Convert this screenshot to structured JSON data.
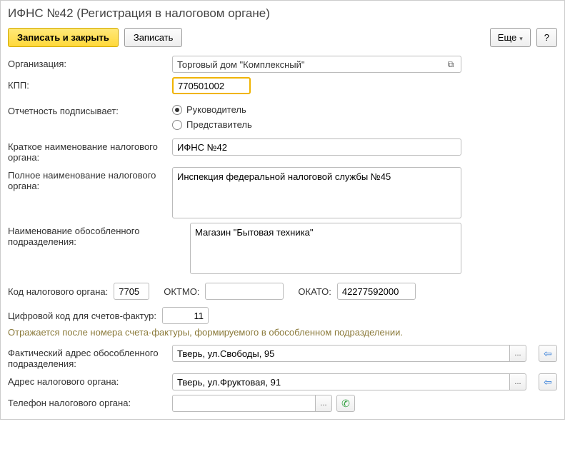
{
  "title": "ИФНС №42 (Регистрация в налоговом органе)",
  "toolbar": {
    "save_close": "Записать и закрыть",
    "save": "Записать",
    "more": "Еще",
    "help": "?"
  },
  "labels": {
    "org": "Организация:",
    "kpp": "КПП:",
    "signer": "Отчетность подписывает:",
    "short_name": "Краткое наименование налогового органа:",
    "full_name": "Полное наименование налогового органа:",
    "subdivision": "Наименование обособленного подразделения:",
    "tax_code": "Код налогового органа:",
    "oktmo": "ОКТМО:",
    "okato": "ОКАТО:",
    "digital_code": "Цифровой код для счетов-фактур:",
    "hint": "Отражается после номера счета-фактуры, формируемого в обособленном подразделении.",
    "actual_address": "Фактический адрес обособленного подразделения:",
    "tax_address": "Адрес налогового органа:",
    "phone": "Телефон налогового органа:"
  },
  "signer_options": {
    "director": "Руководитель",
    "representative": "Представитель",
    "selected": "director"
  },
  "values": {
    "org": "Торговый дом \"Комплексный\"",
    "kpp": "770501002",
    "short_name": "ИФНС №42",
    "full_name": "Инспекция федеральной налоговой службы №45",
    "subdivision": "Магазин \"Бытовая техника\"",
    "tax_code": "7705",
    "oktmo": "",
    "okato": "42277592000",
    "digital_code": "11",
    "actual_address": "Тверь, ул.Свободы, 95",
    "tax_address": "Тверь, ул.Фруктовая, 91",
    "phone": ""
  }
}
